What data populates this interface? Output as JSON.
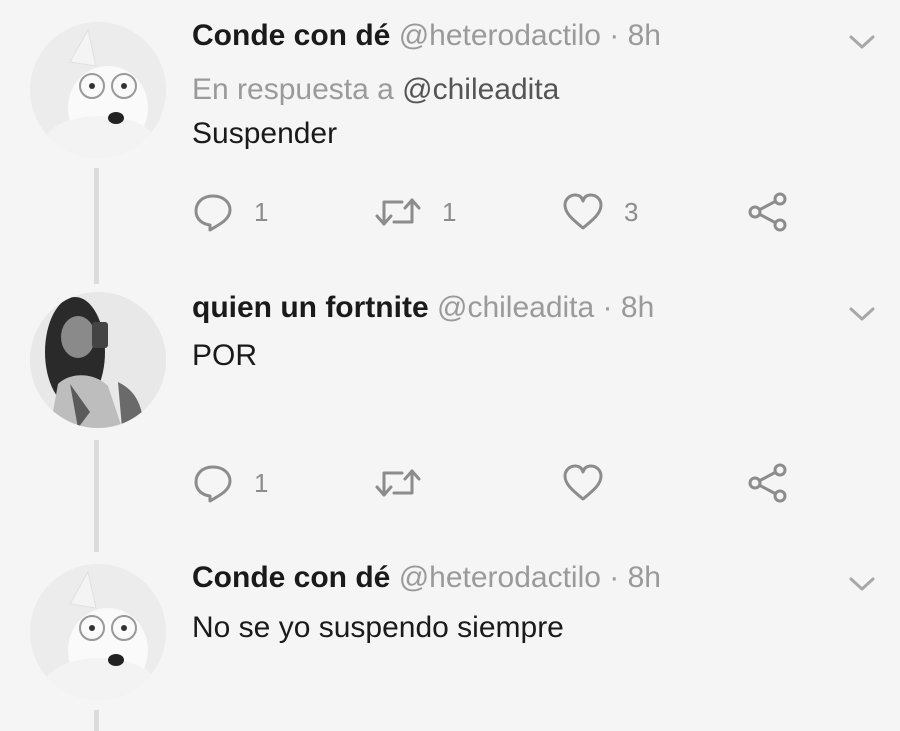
{
  "tweets": [
    {
      "display_name": "Conde con dé",
      "handle": "@heterodactilo",
      "separator": "·",
      "time": "8h",
      "reply_prefix": "En respuesta a",
      "reply_mention": "@chileadita",
      "text": "Suspender",
      "reply_count": "1",
      "retweet_count": "1",
      "like_count": "3"
    },
    {
      "display_name": "quien un fortnite",
      "handle": "@chileadita",
      "separator": "·",
      "time": "8h",
      "text": "POR",
      "reply_count": "1",
      "retweet_count": "",
      "like_count": ""
    },
    {
      "display_name": "Conde con dé",
      "handle": "@heterodactilo",
      "separator": "·",
      "time": "8h",
      "text": "No se yo suspendo siempre"
    }
  ],
  "icons": {
    "reply": "reply-bubble-icon",
    "retweet": "retweet-icon",
    "like": "heart-icon",
    "share": "share-icon",
    "menu": "chevron-down-icon"
  },
  "colors": {
    "background": "#f5f5f5",
    "muted": "#9a9a9a",
    "icon": "#8c8c8c",
    "thread_line": "#dcdcdc"
  }
}
